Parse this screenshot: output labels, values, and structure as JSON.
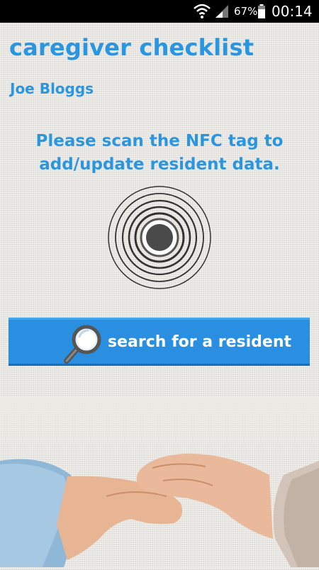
{
  "status_bar": {
    "battery_percent": "67%",
    "time": "00:14",
    "icons": [
      "wifi-icon",
      "cell-signal-icon",
      "battery-icon"
    ]
  },
  "header": {
    "title": "caregiver checklist",
    "user": "Joe Bloggs"
  },
  "main": {
    "instruction": "Please scan the NFC tag to add/update resident data.",
    "nfc_icon": "nfc-target-icon",
    "search_button_label": "search for a resident",
    "search_icon": "magnifier-icon"
  },
  "colors": {
    "accent": "#2a96e0",
    "button": "#2a8fe0",
    "status_bar": "#000000"
  }
}
